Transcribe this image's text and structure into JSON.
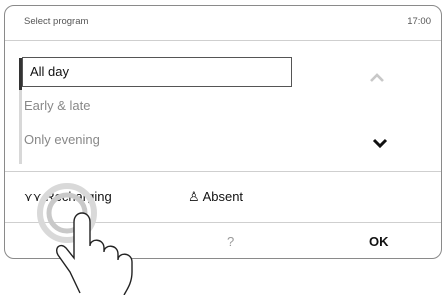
{
  "header": {
    "title": "Select program",
    "time": "17:00"
  },
  "programs": [
    "All day",
    "Early & late",
    "Only evening"
  ],
  "modes": {
    "recharging": "Recharging",
    "absent": "Absent"
  },
  "footer": {
    "help": "?",
    "ok": "OK"
  }
}
